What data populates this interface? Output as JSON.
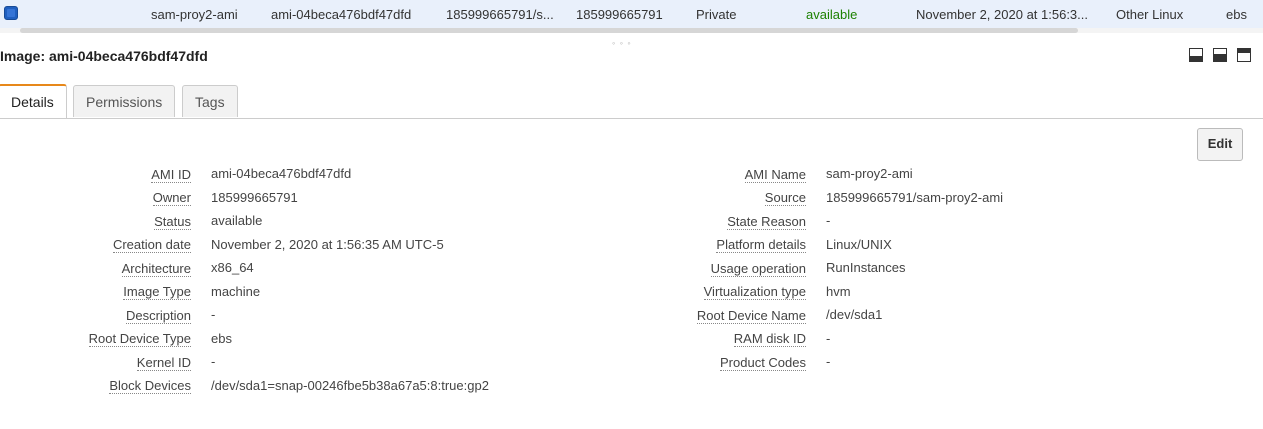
{
  "row": {
    "name": "sam-proy2-ami",
    "ami_id": "ami-04beca476bdf47dfd",
    "source": "185999665791/s...",
    "owner": "185999665791",
    "visibility": "Private",
    "status": "available",
    "creation_date": "November 2, 2020 at 1:56:3...",
    "platform": "Other Linux",
    "root_device": "ebs"
  },
  "detail_title": "Image: ami-04beca476bdf47dfd",
  "tabs": [
    "Details",
    "Permissions",
    "Tags"
  ],
  "edit_label": "Edit",
  "left_fields": [
    {
      "label": "AMI ID",
      "value": "ami-04beca476bdf47dfd"
    },
    {
      "label": "Owner",
      "value": "185999665791"
    },
    {
      "label": "Status",
      "value": "available"
    },
    {
      "label": "Creation date",
      "value": "November 2, 2020 at 1:56:35 AM UTC-5"
    },
    {
      "label": "Architecture",
      "value": "x86_64"
    },
    {
      "label": "Image Type",
      "value": "machine"
    },
    {
      "label": "Description",
      "value": "-"
    },
    {
      "label": "Root Device Type",
      "value": "ebs"
    },
    {
      "label": "Kernel ID",
      "value": "-"
    },
    {
      "label": "Block Devices",
      "value": "/dev/sda1=snap-00246fbe5b38a67a5:8:true:gp2"
    }
  ],
  "right_fields": [
    {
      "label": "AMI Name",
      "value": "sam-proy2-ami"
    },
    {
      "label": "Source",
      "value": "185999665791/sam-proy2-ami"
    },
    {
      "label": "State Reason",
      "value": "-"
    },
    {
      "label": "Platform details",
      "value": "Linux/UNIX"
    },
    {
      "label": "Usage operation",
      "value": "RunInstances"
    },
    {
      "label": "Virtualization type",
      "value": "hvm"
    },
    {
      "label": "Root Device Name",
      "value": "/dev/sda1"
    },
    {
      "label": "RAM disk ID",
      "value": "-"
    },
    {
      "label": "Product Codes",
      "value": "-"
    }
  ],
  "colors": {
    "status_available": "#1d8102",
    "tab_accent": "#e7881a",
    "row_selected": "#e9f0fb"
  }
}
